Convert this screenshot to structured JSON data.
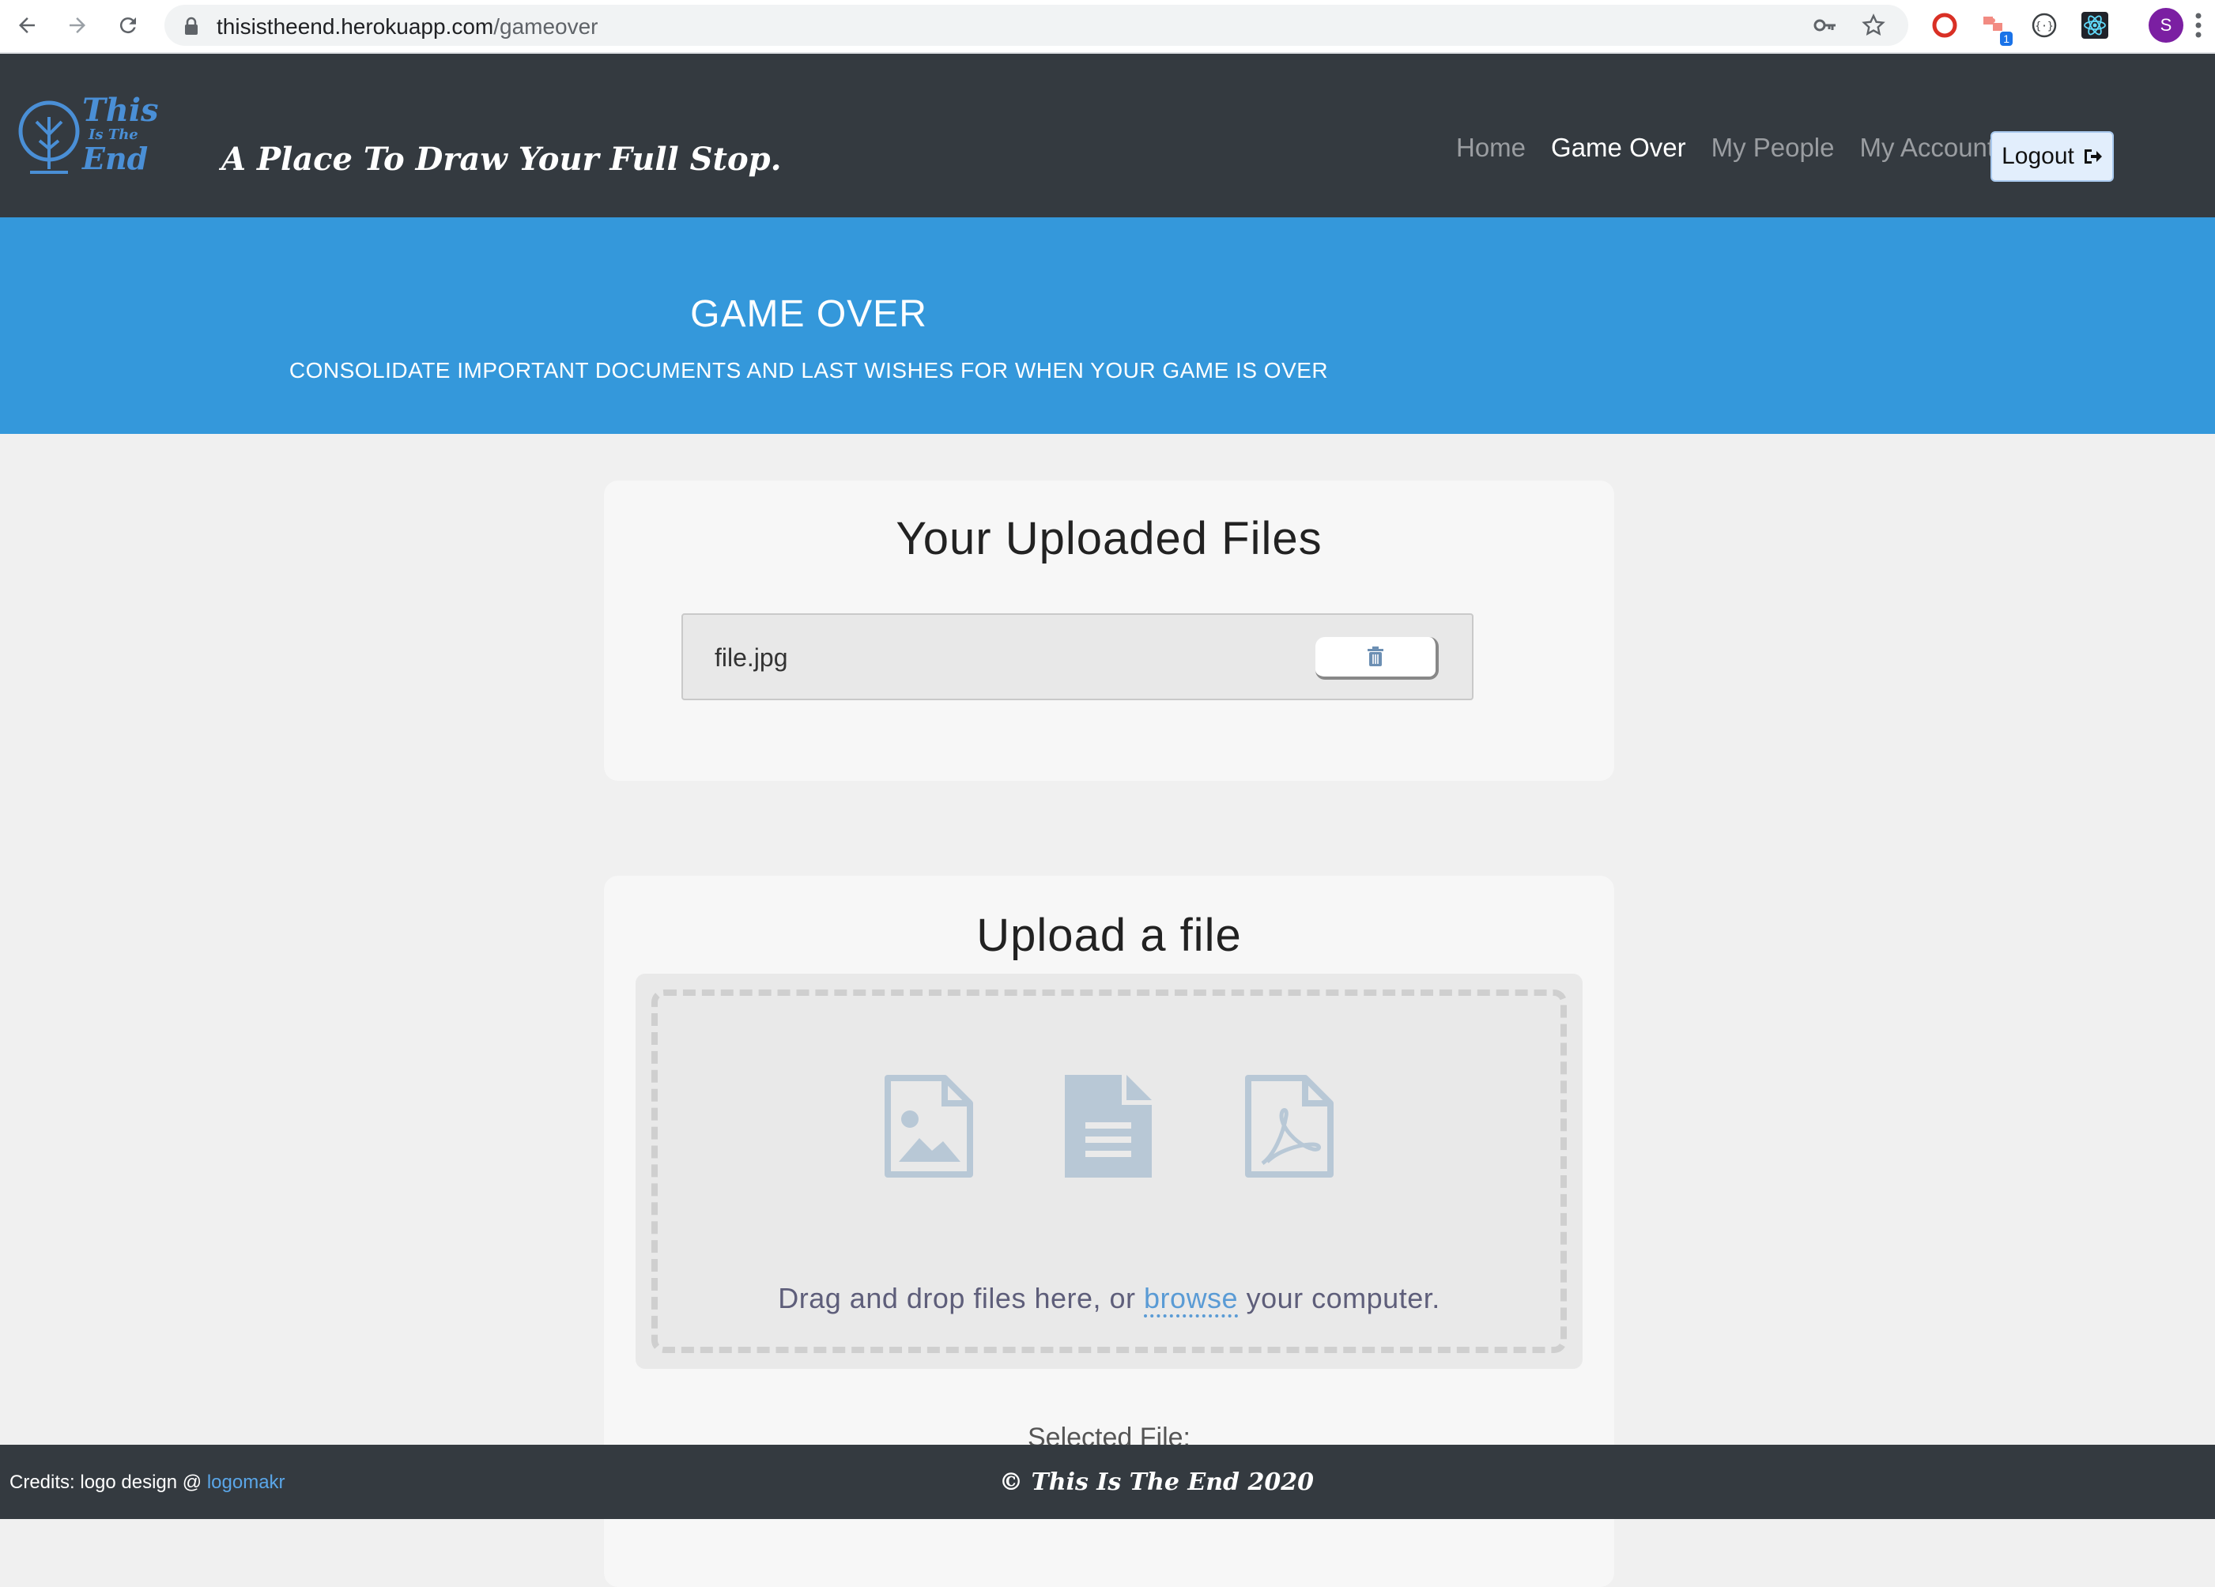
{
  "browser": {
    "url_host": "thisistheend.herokuapp.com",
    "url_path": "/gameover",
    "extension_badge": "1",
    "profile_initial": "S"
  },
  "nav": {
    "logo_text": [
      "This",
      "Is The",
      "End"
    ],
    "tagline": "A Place To Draw Your Full Stop.",
    "links": [
      "Home",
      "Game Over",
      "My People",
      "My Account"
    ],
    "active": "Game Over",
    "logout_label": "Logout"
  },
  "banner": {
    "title": "GAME OVER",
    "subtitle": "CONSOLIDATE IMPORTANT DOCUMENTS AND LAST WISHES FOR WHEN YOUR GAME IS OVER"
  },
  "uploaded": {
    "heading": "Your Uploaded Files",
    "files": [
      "file.jpg"
    ]
  },
  "upload": {
    "heading": "Upload a file",
    "text_before": "Drag and drop files here, or",
    "browse_label": "browse",
    "text_after": "your computer.",
    "icons": [
      "image-file-icon",
      "text-file-icon",
      "pdf-file-icon"
    ],
    "selected_label": "Selected File:"
  },
  "footer": {
    "credits_prefix": "Credits: logo design @",
    "credits_link": "logomakr",
    "copyright": "© This Is The End 2020"
  },
  "colors": {
    "nav_bg": "#343a40",
    "banner_bg": "#3498db",
    "card_bg": "#f7f7f7",
    "page_bg": "#f0f0f0",
    "accent": "#5a9bd5"
  }
}
